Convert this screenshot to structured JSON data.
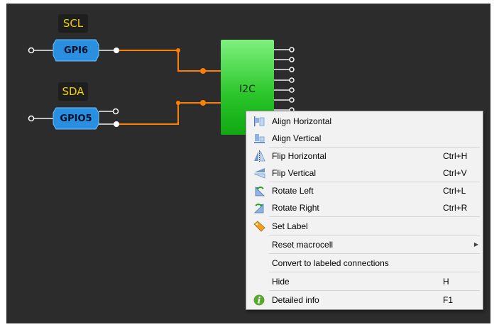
{
  "canvas": {
    "tags": {
      "scl": "SCL",
      "sda": "SDA"
    },
    "blocks": {
      "gpi6": "GPI6",
      "gpio5": "GPIO5",
      "i2c": "I2C"
    },
    "colors": {
      "wire": "#ff8000",
      "block_blue": "#2a8fe0",
      "block_green": "#22c022",
      "tag_text": "#f0d000"
    }
  },
  "context_menu": {
    "items": [
      {
        "label": "Align Horizontal",
        "shortcut": "",
        "icon": "align-horizontal-icon"
      },
      {
        "label": "Align Vertical",
        "shortcut": "",
        "icon": "align-vertical-icon"
      },
      {
        "label": "Flip Horizontal",
        "shortcut": "Ctrl+H",
        "icon": "flip-horizontal-icon"
      },
      {
        "label": "Flip Vertical",
        "shortcut": "Ctrl+V",
        "icon": "flip-vertical-icon"
      },
      {
        "label": "Rotate Left",
        "shortcut": "Ctrl+L",
        "icon": "rotate-left-icon"
      },
      {
        "label": "Rotate Right",
        "shortcut": "Ctrl+R",
        "icon": "rotate-right-icon"
      },
      {
        "label": "Set Label",
        "shortcut": "",
        "icon": "tag-icon"
      },
      {
        "label": "Reset macrocell",
        "shortcut": "",
        "icon": "",
        "submenu": true
      },
      {
        "label": "Convert to labeled connections",
        "shortcut": "",
        "icon": ""
      },
      {
        "label": "Hide",
        "shortcut": "H",
        "icon": ""
      },
      {
        "label": "Detailed info",
        "shortcut": "F1",
        "icon": "info-icon"
      }
    ]
  }
}
